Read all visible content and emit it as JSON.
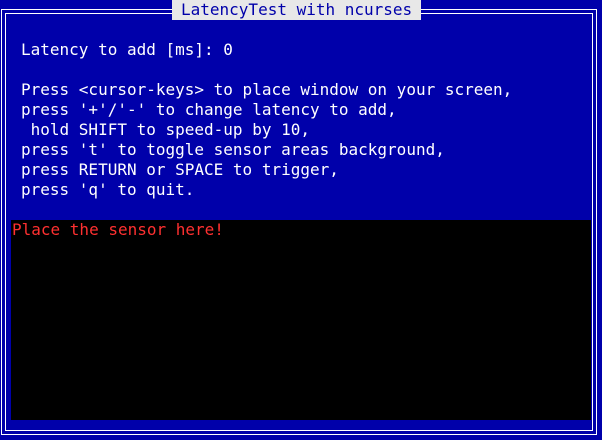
{
  "window": {
    "title": "LatencyTest with ncurses"
  },
  "status": {
    "latency_label": "Latency to add [ms]: ",
    "latency_value": "0"
  },
  "instructions": [
    "Press <cursor-keys> to place window on your screen,",
    "press '+'/'-' to change latency to add,",
    " hold SHIFT to speed-up by 10,",
    "press 't' to toggle sensor areas background,",
    "press RETURN or SPACE to trigger,",
    "press 'q' to quit."
  ],
  "sensor": {
    "label": "Place the sensor here!"
  },
  "colors": {
    "background": "#0000aa",
    "text": "#ffffff",
    "title_bg": "#e8e8e8",
    "sensor_bg": "#000000",
    "sensor_text": "#ff3030"
  }
}
